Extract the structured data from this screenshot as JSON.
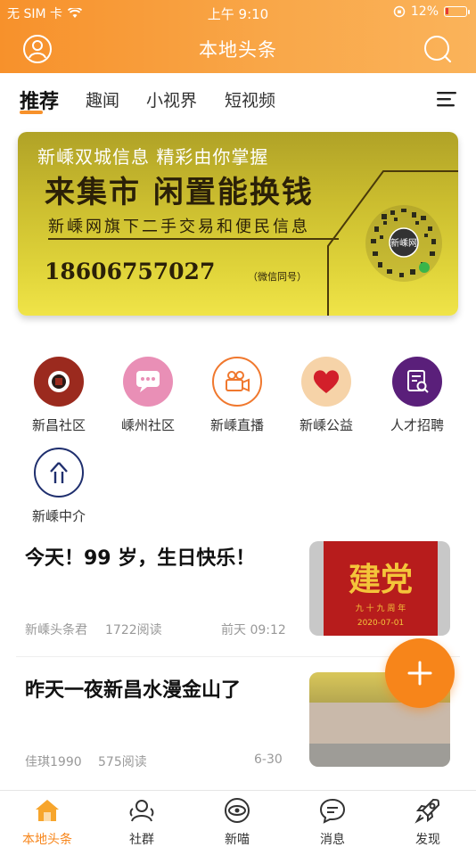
{
  "status": {
    "carrier": "无 SIM 卡",
    "time": "上午 9:10",
    "battery": "12%"
  },
  "header": {
    "title": "本地头条"
  },
  "tabs": [
    "推荐",
    "趣闻",
    "小视界",
    "短视频"
  ],
  "banner": {
    "line1": "新嵊双城信息 精彩由你掌握",
    "line2": "来集市 闲置能换钱",
    "line3": "新嵊网旗下二手交易和便民信息",
    "phone": "18606757027",
    "phone_note": "（微信同号）",
    "qr_text": "新嵊网"
  },
  "quicknav": [
    {
      "label": "新昌社区",
      "icon": "camera-lens-icon",
      "color": "#9b2a1e"
    },
    {
      "label": "嵊州社区",
      "icon": "chat-bubble-icon",
      "color": "#e98fb6"
    },
    {
      "label": "新嵊直播",
      "icon": "video-camera-icon",
      "color": "#f0782e"
    },
    {
      "label": "新嵊公益",
      "icon": "heart-icon",
      "color": "#d21f2a"
    },
    {
      "label": "人才招聘",
      "icon": "resume-search-icon",
      "color": "#5a1f7a"
    },
    {
      "label": "新嵊中介",
      "icon": "agency-icon",
      "color": "#1f2f6e"
    }
  ],
  "articles": [
    {
      "title": "今天！99 岁，生日快乐！",
      "author": "新嵊头条君",
      "reads": "1722阅读",
      "time": "前天 09:12",
      "thumb": {
        "big": "建党",
        "sub": "九 十 九 周 年",
        "date": "2020-07-01"
      }
    },
    {
      "title": "昨天一夜新昌水漫金山了",
      "author": "佳琪1990",
      "reads": "575阅读",
      "time": "6-30"
    }
  ],
  "bottom_nav": [
    {
      "label": "本地头条",
      "icon": "home-icon",
      "active": true
    },
    {
      "label": "社群",
      "icon": "community-icon"
    },
    {
      "label": "新喵",
      "icon": "eye-icon"
    },
    {
      "label": "消息",
      "icon": "message-icon"
    },
    {
      "label": "发现",
      "icon": "rocket-icon"
    }
  ],
  "colors": {
    "accent": "#f7851a",
    "header_start": "#f7912b",
    "header_end": "#fab35a"
  }
}
